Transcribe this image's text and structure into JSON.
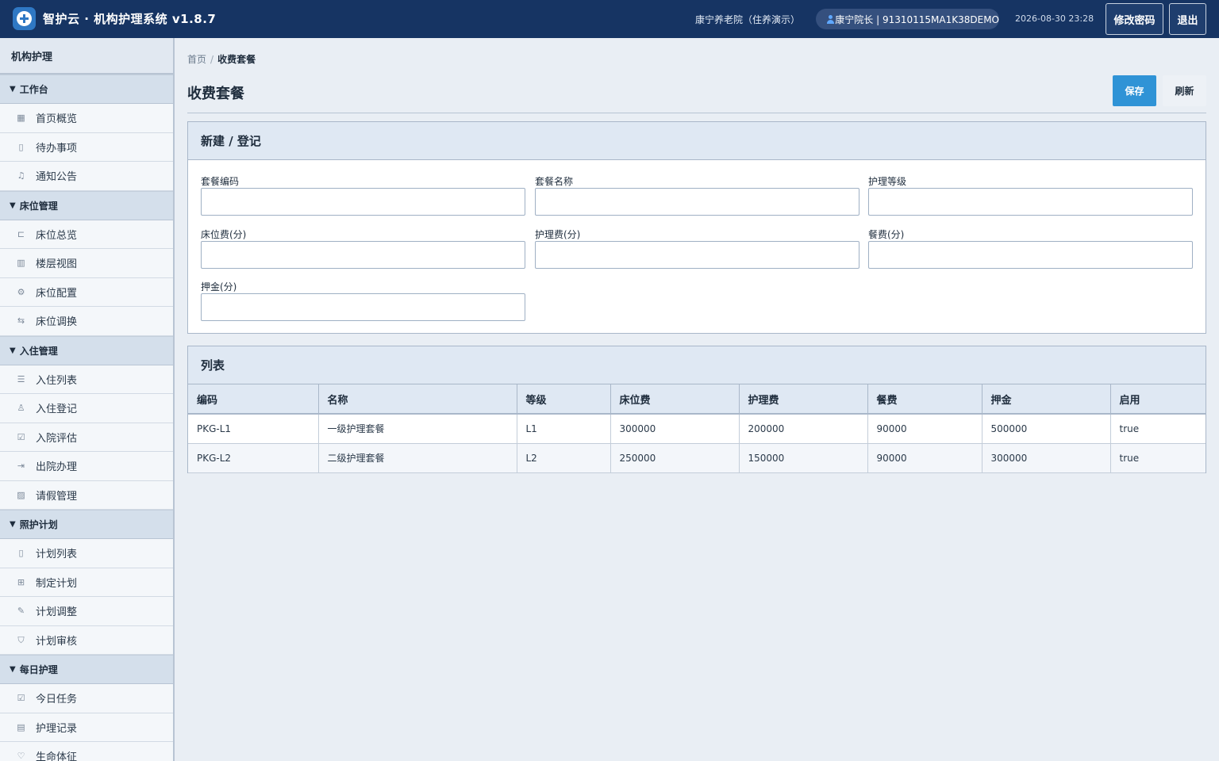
{
  "header": {
    "app_title": "智护云 · 机构护理系统 v1.8.7",
    "org": "康宁养老院（住养演示）",
    "user": "康宁院长 | 91310115MA1K38DEMO",
    "datetime": "2026-08-30 23:28",
    "change_password": "修改密码",
    "logout": "退出"
  },
  "sidebar": {
    "title": "机构护理",
    "groups": [
      {
        "label": "工作台",
        "items": [
          "首页概览",
          "待办事项",
          "通知公告"
        ]
      },
      {
        "label": "床位管理",
        "items": [
          "床位总览",
          "楼层视图",
          "床位配置",
          "床位调换"
        ]
      },
      {
        "label": "入住管理",
        "items": [
          "入住列表",
          "入住登记",
          "入院评估",
          "出院办理",
          "请假管理"
        ]
      },
      {
        "label": "照护计划",
        "items": [
          "计划列表",
          "制定计划",
          "计划调整",
          "计划审核"
        ]
      },
      {
        "label": "每日护理",
        "items": [
          "今日任务",
          "护理记录",
          "生命体征"
        ]
      }
    ]
  },
  "breadcrumb": {
    "home": "首页",
    "sep": "/",
    "current": "收费套餐"
  },
  "page": {
    "title": "收费套餐",
    "save": "保存",
    "refresh": "刷新"
  },
  "form": {
    "title": "新建 / 登记",
    "fields": [
      {
        "label": "套餐编码",
        "value": ""
      },
      {
        "label": "套餐名称",
        "value": ""
      },
      {
        "label": "护理等级",
        "value": ""
      },
      {
        "label": "床位费(分)",
        "value": ""
      },
      {
        "label": "护理费(分)",
        "value": ""
      },
      {
        "label": "餐费(分)",
        "value": ""
      },
      {
        "label": "押金(分)",
        "value": ""
      }
    ]
  },
  "list": {
    "title": "列表",
    "columns": [
      "编码",
      "名称",
      "等级",
      "床位费",
      "护理费",
      "餐费",
      "押金",
      "启用"
    ],
    "rows": [
      [
        "PKG-L1",
        "一级护理套餐",
        "L1",
        "300000",
        "200000",
        "90000",
        "500000",
        "true"
      ],
      [
        "PKG-L2",
        "二级护理套餐",
        "L2",
        "250000",
        "150000",
        "90000",
        "300000",
        "true"
      ]
    ]
  }
}
